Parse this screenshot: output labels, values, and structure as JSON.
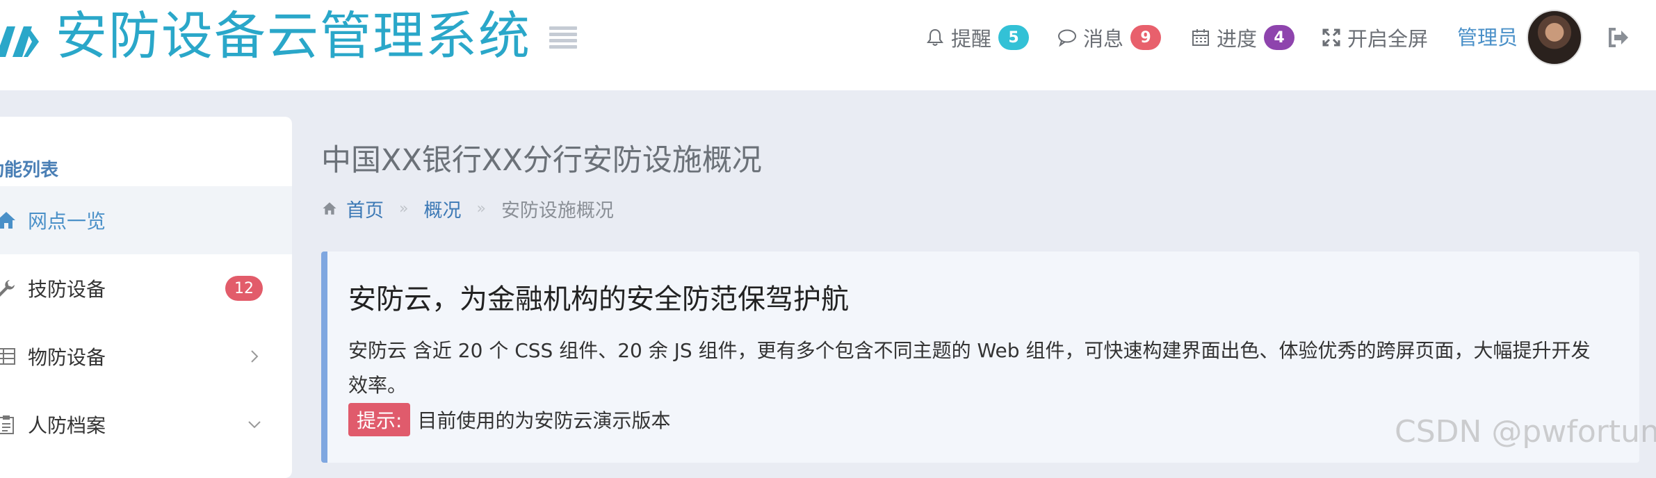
{
  "header": {
    "app_title": "安防设备云管理系统",
    "nav": {
      "alerts": {
        "label": "提醒",
        "count": "5",
        "color": "#33c1d6"
      },
      "messages": {
        "label": "消息",
        "count": "9",
        "color": "#e8606c"
      },
      "progress": {
        "label": "进度",
        "count": "4",
        "color": "#8e44ad"
      },
      "fullscreen": {
        "label": "开启全屏"
      }
    },
    "admin_name": "管理员"
  },
  "sidebar": {
    "title": "功能列表",
    "items": [
      {
        "label": "网点一览",
        "icon": "home-icon",
        "active": true
      },
      {
        "label": "技防设备",
        "icon": "wrench-icon",
        "badge": "12"
      },
      {
        "label": "物防设备",
        "icon": "grid-icon",
        "arrow": "chevron-right-icon"
      },
      {
        "label": "人防档案",
        "icon": "clipboard-icon",
        "arrow": "chevron-down-icon"
      }
    ]
  },
  "main": {
    "page_title": "中国XX银行XX分行安防设施概况",
    "breadcrumb": [
      "首页",
      "概况",
      "安防设施概况"
    ],
    "callout": {
      "title": "安防云，为金融机构的安全防范保驾护航",
      "text": "安防云 含近 20 个 CSS 组件、20 余 JS 组件，更有多个包含不同主题的 Web 组件，可快速构建界面出色、体验优秀的跨屏页面，大幅提升开发效率。",
      "tip_label": "提示:",
      "tip_text": "目前使用的为安防云演示版本"
    }
  },
  "watermark": "CSDN @pwfortune",
  "colors": {
    "brand": "#2aa7c9",
    "link": "#3b78b5",
    "accent_border": "#7fa7e0",
    "danger": "#e05b6c"
  }
}
